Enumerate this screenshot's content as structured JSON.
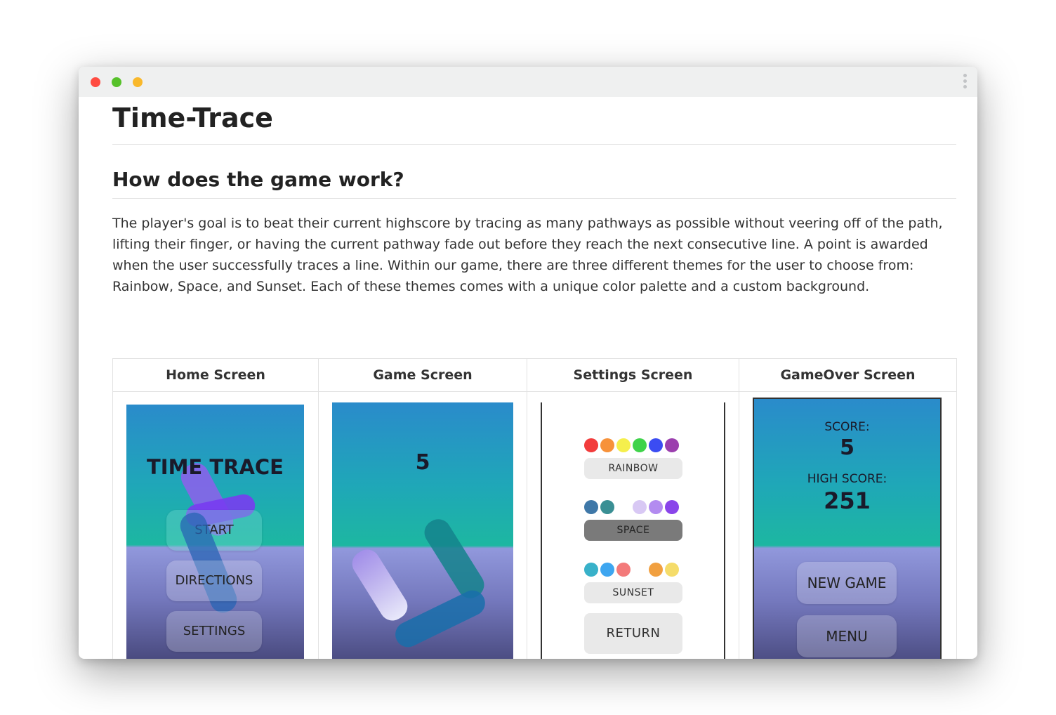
{
  "window": {
    "controls": [
      "close",
      "minimize",
      "maximize"
    ],
    "menu_icon": "kebab-menu-icon"
  },
  "page": {
    "title": "Time-Trace",
    "section_title": "How does the game work?",
    "paragraph": "The player's goal is to beat their current highscore by tracing as many pathways as possible without veering off of the path, lifting their finger, or having the current pathway fade out before they reach the next consecutive line. A point is awarded when the user successfully traces a line. Within our game, there are three different themes for the user to choose from: Rainbow, Space, and Sunset. Each of these themes comes with a unique color palette and a custom background."
  },
  "table": {
    "headers": [
      "Home Screen",
      "Game Screen",
      "Settings Screen",
      "GameOver Screen"
    ]
  },
  "home_screen": {
    "title": "TIME TRACE",
    "buttons": [
      "START",
      "DIRECTIONS",
      "SETTINGS"
    ]
  },
  "game_screen": {
    "score": "5"
  },
  "settings_screen": {
    "themes": [
      {
        "label": "RAINBOW",
        "colors": [
          "#f23c3c",
          "#f7923a",
          "#f5ef4c",
          "#3fd34a",
          "#3b4cf2",
          "#9b3fae"
        ]
      },
      {
        "label": "SPACE",
        "colors": [
          "#3f78a8",
          "#3a8f94",
          "#ffffff",
          "#d8c8f4",
          "#b38bf0",
          "#8a45ea"
        ]
      },
      {
        "label": "SUNSET",
        "colors": [
          "#38b1c9",
          "#3ea6f0",
          "#f37a7a",
          "#ffffff",
          "#f1a040",
          "#f5dc6a"
        ]
      }
    ],
    "return_label": "RETURN"
  },
  "gameover_screen": {
    "score_label": "SCORE:",
    "score": "5",
    "high_score_label": "HIGH SCORE:",
    "high_score": "251",
    "buttons": [
      "NEW GAME",
      "MENU"
    ]
  },
  "colors": {
    "close": "#ff4b41",
    "minimize": "#56c12a",
    "maximize": "#f9b82b",
    "gradient_top": "#2a8bcb",
    "gradient_teal": "#1db7a1",
    "gradient_lavender": "#9198dc",
    "gradient_bottom": "#3f3f70"
  }
}
